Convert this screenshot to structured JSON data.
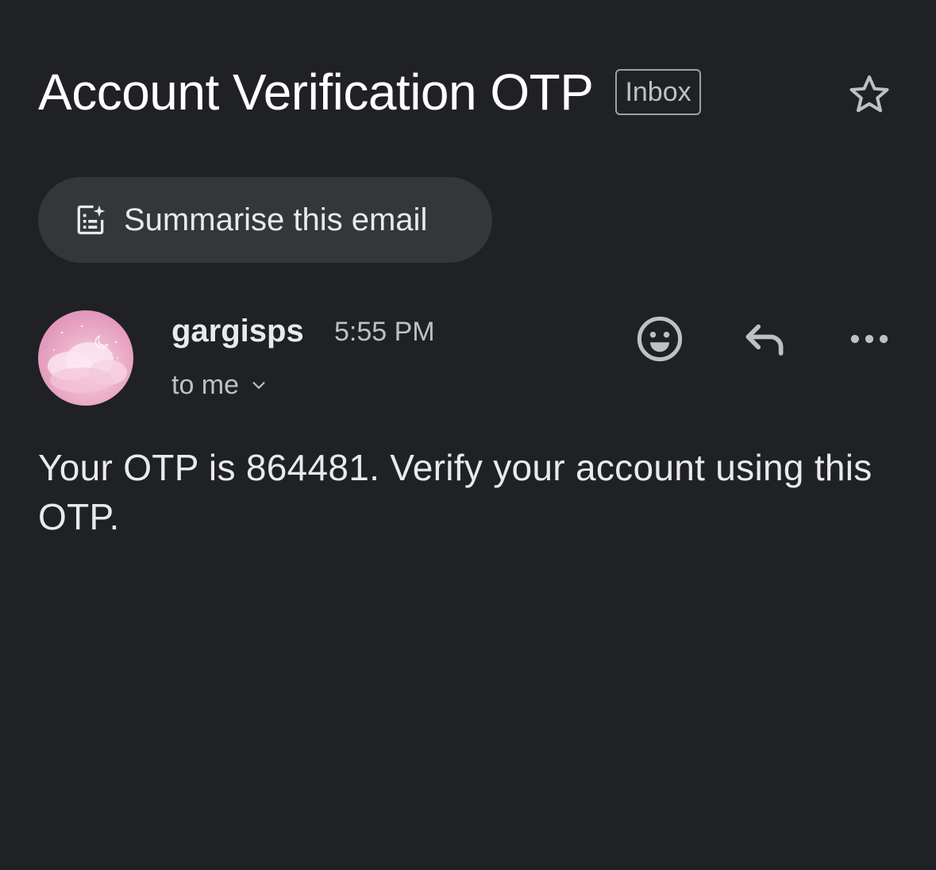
{
  "email": {
    "subject": "Account Verification OTP",
    "label_badge": "Inbox",
    "summarise_label": "Summarise this email",
    "sender": {
      "name": "gargisps",
      "time": "5:55 PM",
      "recipient_text": "to me"
    },
    "body": "Your OTP is 864481. Verify your account using this OTP."
  },
  "icons": {
    "star": "star-outline-icon",
    "summarise": "summarise-sparkle-icon",
    "emoji": "emoji-smile-icon",
    "reply": "reply-arrow-icon",
    "more": "more-horizontal-icon",
    "expand": "chevron-down-icon"
  },
  "colors": {
    "background": "#202124",
    "chip": "#353638",
    "text_primary": "#ffffff",
    "text_secondary": "#bdc1c6",
    "icon": "#bdc1c6",
    "avatar_pink": "#eeb5cd"
  }
}
